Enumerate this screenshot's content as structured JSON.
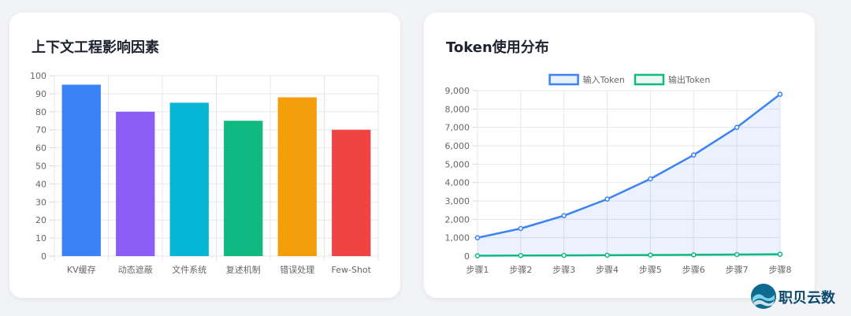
{
  "charts": [
    {
      "title": "上下文工程影响因素",
      "chart_data": {
        "type": "bar",
        "categories": [
          "KV缓存",
          "动态遮蔽",
          "文件系统",
          "复述机制",
          "错误处理",
          "Few-Shot"
        ],
        "values": [
          95,
          80,
          85,
          75,
          88,
          70
        ],
        "colors": [
          "#3b82f6",
          "#8b5cf6",
          "#06b6d4",
          "#10b981",
          "#f59e0b",
          "#ef4444"
        ],
        "ylim": [
          0,
          100
        ],
        "yticks": [
          "0",
          "10",
          "20",
          "30",
          "40",
          "50",
          "60",
          "70",
          "80",
          "90",
          "100"
        ],
        "grid": true
      }
    },
    {
      "title": "Token使用分布",
      "chart_data": {
        "type": "line",
        "categories": [
          "步骤1",
          "步骤2",
          "步骤3",
          "步骤4",
          "步骤5",
          "步骤6",
          "步骤7",
          "步骤8"
        ],
        "series": [
          {
            "name": "输入Token",
            "values": [
              1000,
              1500,
              2200,
              3100,
              4200,
              5500,
              7000,
              8800
            ],
            "color": "#3b82f6",
            "fill": true
          },
          {
            "name": "输出Token",
            "values": [
              20,
              30,
              40,
              50,
              60,
              70,
              85,
              100
            ],
            "color": "#10b981",
            "fill": false
          }
        ],
        "ylim": [
          0,
          9000
        ],
        "yticks": [
          "0",
          "1,000",
          "2,000",
          "3,000",
          "4,000",
          "5,000",
          "6,000",
          "7,000",
          "8,000",
          "9,000"
        ],
        "legend": "top",
        "grid": true
      }
    }
  ],
  "watermark": {
    "text": "职贝云数"
  }
}
